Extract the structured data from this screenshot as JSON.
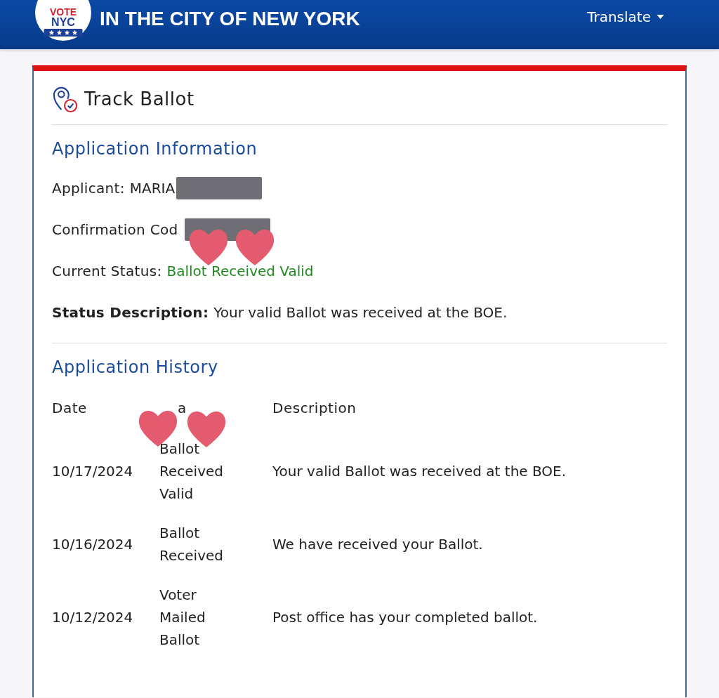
{
  "header": {
    "logo": {
      "top": "VOTE",
      "bottom": "NYC"
    },
    "title_lines": [
      "IN THE CITY OF NEW YORK"
    ],
    "translate": "Translate"
  },
  "card": {
    "title": "Track Ballot",
    "info": {
      "heading": "Application Information",
      "fields": [
        {
          "label": "Applicant:",
          "value": "MARIA",
          "kind": "redacted",
          "label_bold": false
        },
        {
          "label": "Confirmation Cod",
          "kind": "redacted",
          "label_bold": false
        },
        {
          "label": "Current Status:",
          "value": "Ballot Received Valid",
          "kind": "status",
          "label_bold": false
        },
        {
          "label": "Status Description:",
          "value": "Your valid Ballot was received at the BOE.",
          "kind": "plain",
          "label_bold": true
        }
      ]
    },
    "history": {
      "heading": "Application History",
      "columns": [
        "Date",
        "a",
        "Description"
      ],
      "rows": [
        {
          "date": "10/17/2024",
          "status": "Ballot Received Valid",
          "description": "Your valid Ballot was received at the BOE."
        },
        {
          "date": "10/16/2024",
          "status": "Ballot Received",
          "description": "We have received your Ballot."
        },
        {
          "date": "10/12/2024",
          "status": "Voter Mailed Ballot",
          "description": "Post office has your completed ballot."
        }
      ]
    }
  }
}
